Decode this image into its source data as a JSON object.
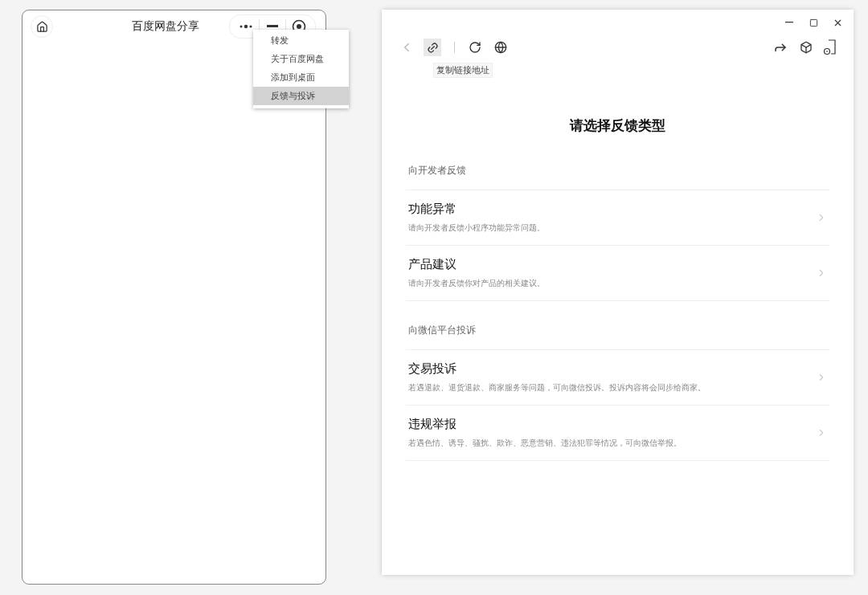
{
  "mini_program": {
    "title": "百度网盘分享",
    "menu": {
      "items": [
        {
          "label": "转发",
          "selected": false
        },
        {
          "label": "关于百度网盘",
          "selected": false
        },
        {
          "label": "添加到桌面",
          "selected": false
        },
        {
          "label": "反馈与投诉",
          "selected": true
        }
      ]
    }
  },
  "feedback_window": {
    "tooltip": "复制链接地址",
    "heading": "请选择反馈类型",
    "sections": [
      {
        "title": "向开发者反馈",
        "items": [
          {
            "title": "功能异常",
            "description": "请向开发者反馈小程序功能异常问题。"
          },
          {
            "title": "产品建议",
            "description": "请向开发者反馈你对产品的相关建议。"
          }
        ]
      },
      {
        "title": "向微信平台投诉",
        "items": [
          {
            "title": "交易投诉",
            "description": "若遇退款、退货退款、商家服务等问题，可向微信投诉。投诉内容将会同步给商家。"
          },
          {
            "title": "违规举报",
            "description": "若遇色情、诱导、骚扰、欺诈、恶意营销、违法犯罪等情况，可向微信举报。"
          }
        ]
      }
    ]
  }
}
